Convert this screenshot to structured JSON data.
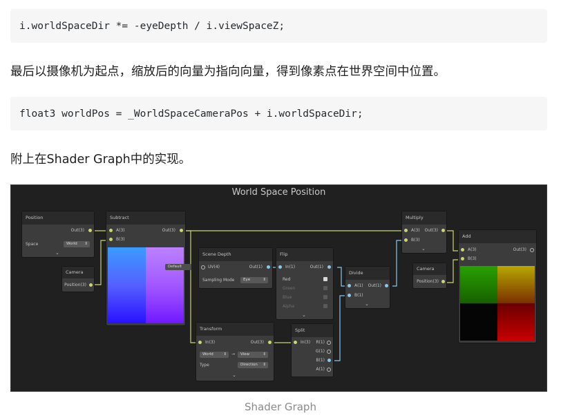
{
  "code1": "i.worldSpaceDir *= -eyeDepth / i.viewSpaceZ;",
  "paragraph1": "最后以摄像机为起点，缩放后的向量为指向向量，得到像素点在世界空间中位置。",
  "code2": "float3 worldPos = _WorldSpaceCameraPos + i.worldSpaceDir;",
  "paragraph2": "附上在Shader Graph中的实现。",
  "graph": {
    "title": "World Space Position",
    "position_node": {
      "title": "Position",
      "out": "Out(3)",
      "space_label": "Space",
      "space_value": "World"
    },
    "camera_node": {
      "title": "Camera",
      "out": "Position(3)"
    },
    "subtract_node": {
      "title": "Subtract",
      "in_a": "A(3)",
      "in_b": "B(3)",
      "out": "Out(3)"
    },
    "scene_depth_node": {
      "title": "Scene Depth",
      "in_uv": "UV(4)",
      "default_label": "Default",
      "out": "Out(1)",
      "sampling_label": "Sampling Mode",
      "sampling_value": "Eye"
    },
    "flip_node": {
      "title": "Flip",
      "in": "In(1)",
      "out": "Out(1)",
      "channels": [
        "Red",
        "Green",
        "Blue",
        "Alpha"
      ]
    },
    "divide_node": {
      "title": "Divide",
      "in_a": "A(1)",
      "in_b": "B(1)",
      "out": "Out(1)"
    },
    "multiply_node": {
      "title": "Multiply",
      "in_a": "A(3)",
      "in_b": "B(3)",
      "out": "Out(3)"
    },
    "camera2_node": {
      "title": "Camera",
      "out": "Position(3)"
    },
    "add_node": {
      "title": "Add",
      "in_a": "A(3)",
      "in_b": "B(3)",
      "out": "Out(3)"
    },
    "transform_node": {
      "title": "Transform",
      "in": "In(3)",
      "out": "Out(3)",
      "from": "World",
      "to": "View",
      "type_label": "Type",
      "type_value": "Direction"
    },
    "split_node": {
      "title": "Split",
      "in": "In(3)",
      "outs": [
        "R(1)",
        "G(1)",
        "B(1)",
        "A(1)"
      ]
    }
  },
  "caption": "Shader Graph",
  "colors": {
    "port": "#ccd56e",
    "wire": "#ccd56e",
    "wire_float": "#88c9ee",
    "code_bg": "#f6f6f6"
  }
}
